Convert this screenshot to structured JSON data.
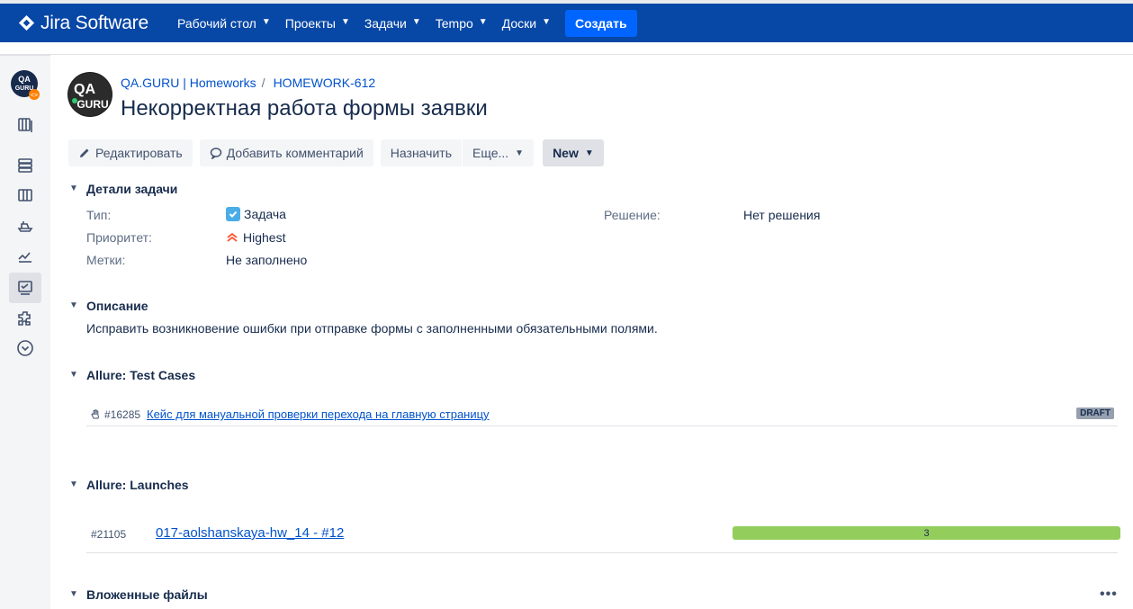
{
  "topnav": {
    "logo_text": "Jira Software",
    "items": [
      {
        "label": "Рабочий стол"
      },
      {
        "label": "Проекты"
      },
      {
        "label": "Задачи"
      },
      {
        "label": "Tempo"
      },
      {
        "label": "Доски"
      }
    ],
    "create_label": "Создать"
  },
  "sidebar": {
    "icons": [
      "project-avatar",
      "backlog-icon",
      "releases-icon",
      "board-icon",
      "ship-icon",
      "reports-icon",
      "issues-icon",
      "add-ons-icon",
      "more-icon"
    ]
  },
  "breadcrumb": {
    "project": "QA.GURU | Homeworks",
    "issue_key": "HOMEWORK-612",
    "separator": "/"
  },
  "issue": {
    "title": "Некорректная работа формы заявки"
  },
  "toolbar": {
    "edit_label": "Редактировать",
    "comment_label": "Добавить комментарий",
    "assign_label": "Назначить",
    "more_label": "Еще...",
    "status_label": "New"
  },
  "details": {
    "heading": "Детали задачи",
    "type_label": "Тип:",
    "type_value": "Задача",
    "priority_label": "Приоритет:",
    "priority_value": "Highest",
    "labels_label": "Метки:",
    "labels_value": "Не заполнено",
    "resolution_label": "Решение:",
    "resolution_value": "Нет решения"
  },
  "description": {
    "heading": "Описание",
    "text": "Исправить возникновение ошибки при отправке формы с заполненными обязательными полями."
  },
  "allure_test_cases": {
    "heading": "Allure: Test Cases",
    "items": [
      {
        "id": "#16285",
        "name": "Кейс для мануальной проверки перехода на главную страницу",
        "status": "DRAFT"
      }
    ]
  },
  "allure_launches": {
    "heading": "Allure: Launches",
    "items": [
      {
        "id": "#21105",
        "name": "017-aolshanskaya-hw_14 - #12",
        "bar_value": "3"
      }
    ]
  },
  "attachments": {
    "heading": "Вложенные файлы",
    "more_label": "•••"
  },
  "colors": {
    "nav_bg": "#0747a6",
    "create_bg": "#0065ff",
    "link": "#0052cc",
    "launch_bar": "#93cd5c",
    "priority": "#ff5630"
  }
}
